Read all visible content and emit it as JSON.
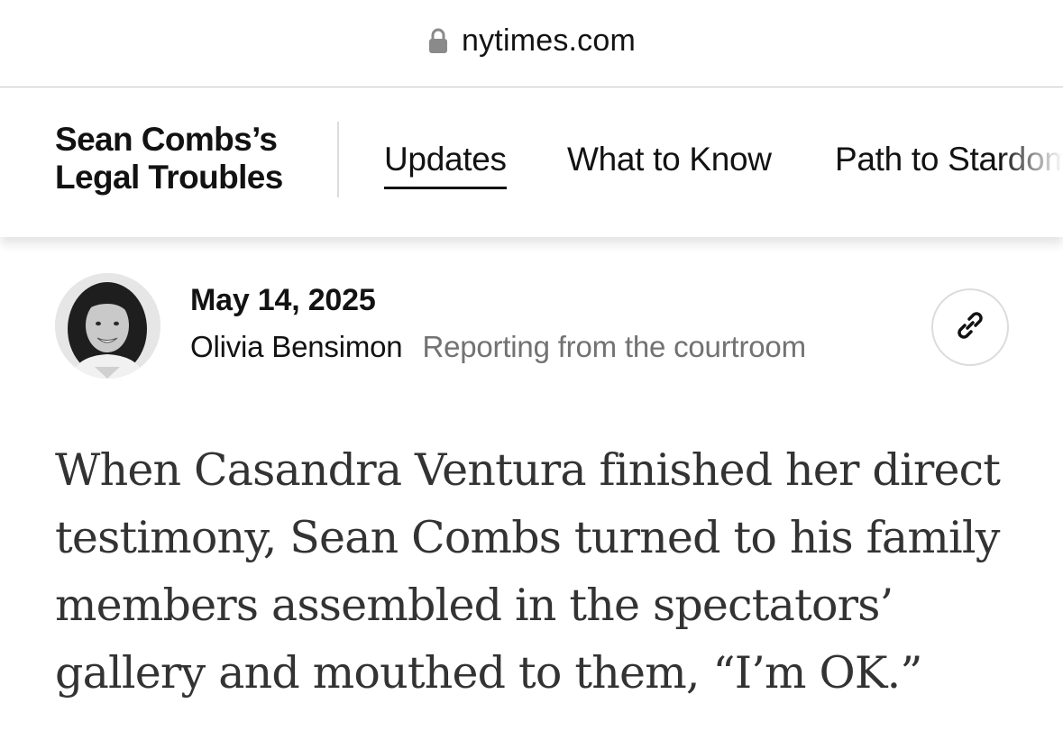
{
  "browser": {
    "url": "nytimes.com",
    "lock_icon": "lock-icon"
  },
  "nav": {
    "title": "Sean Combs’s Legal Troubles",
    "title_line1": "Sean Combs’s",
    "title_line2": "Legal Troubles",
    "tabs": [
      {
        "label": "Updates",
        "active": true
      },
      {
        "label": "What to Know",
        "active": false
      },
      {
        "label": "Path to Stardom",
        "active": false
      }
    ]
  },
  "post": {
    "date": "May 14, 2025",
    "author": "Olivia Bensimon",
    "location": "Reporting from the courtroom",
    "avatar_icon": "author-avatar",
    "share_icon": "link-icon"
  },
  "article": {
    "body": "When Casandra Ventura finished her direct testimony, Sean Combs turned to his family members assembled in the spectators’ gallery and mouthed to them, “I’m OK.”"
  },
  "colors": {
    "text_primary": "#121212",
    "text_body": "#333333",
    "text_secondary": "#727272",
    "divider": "#dcdcdc",
    "background": "#ffffff"
  }
}
